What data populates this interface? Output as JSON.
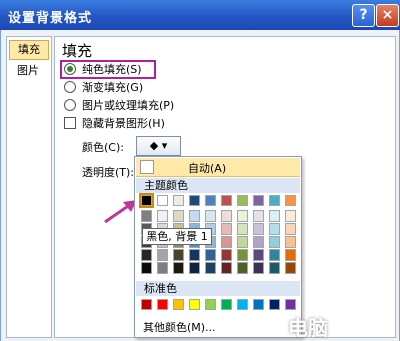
{
  "window": {
    "title": "设置背景格式",
    "help": "?",
    "close": "×"
  },
  "sidebar": {
    "items": [
      {
        "label": "填充"
      },
      {
        "label": "图片"
      }
    ]
  },
  "panel": {
    "heading": "填充",
    "options": [
      {
        "label": "纯色填充(S)",
        "type": "radio",
        "selected": true
      },
      {
        "label": "渐变填充(G)",
        "type": "radio",
        "selected": false
      },
      {
        "label": "图片或纹理填充(P)",
        "type": "radio",
        "selected": false
      },
      {
        "label": "隐藏背景图形(H)",
        "type": "checkbox",
        "checked": false
      }
    ],
    "color_label": "颜色(C):",
    "color_button_glyph": "◆ ▾",
    "transparency_label": "透明度(T):"
  },
  "dropdown": {
    "auto": "自动(A)",
    "theme_header": "主题颜色",
    "standard_header": "标准色",
    "more": "其他颜色(M)...",
    "tooltip": "黑色, 背景 1",
    "theme_colors": [
      [
        "#000000",
        "#ffffff",
        "#eeece1",
        "#1f497d",
        "#4f81bd",
        "#c0504d",
        "#9bbb59",
        "#8064a2",
        "#4bacc6",
        "#f79646"
      ],
      [
        "#7f7f7f",
        "#f2f2f2",
        "#ddd9c3",
        "#c6d9f0",
        "#dbe5f1",
        "#f2dcdb",
        "#ebf1dd",
        "#e5e0ec",
        "#dbeef3",
        "#fdeada"
      ],
      [
        "#595959",
        "#d8d8d8",
        "#c4bd97",
        "#8db3e2",
        "#b8cce4",
        "#e5b9b7",
        "#d7e3bc",
        "#ccc1d9",
        "#b7dde8",
        "#fbd5b5"
      ],
      [
        "#3f3f3f",
        "#bfbfbf",
        "#938953",
        "#548dd4",
        "#95b3d7",
        "#d99694",
        "#c3d69b",
        "#b2a2c7",
        "#92cddc",
        "#fac08f"
      ],
      [
        "#262626",
        "#a5a5a5",
        "#494429",
        "#17365d",
        "#366092",
        "#953734",
        "#76923c",
        "#5f497a",
        "#31859b",
        "#e36c09"
      ],
      [
        "#0c0c0c",
        "#7f7f7f",
        "#1d1b10",
        "#0f243e",
        "#244061",
        "#632423",
        "#4f6128",
        "#3f3151",
        "#205867",
        "#974806"
      ]
    ],
    "standard_colors": [
      "#c00000",
      "#ff0000",
      "#ffc000",
      "#ffff00",
      "#92d050",
      "#00b050",
      "#00b0f0",
      "#0070c0",
      "#002060",
      "#7030a0"
    ]
  },
  "watermark": "电脑"
}
